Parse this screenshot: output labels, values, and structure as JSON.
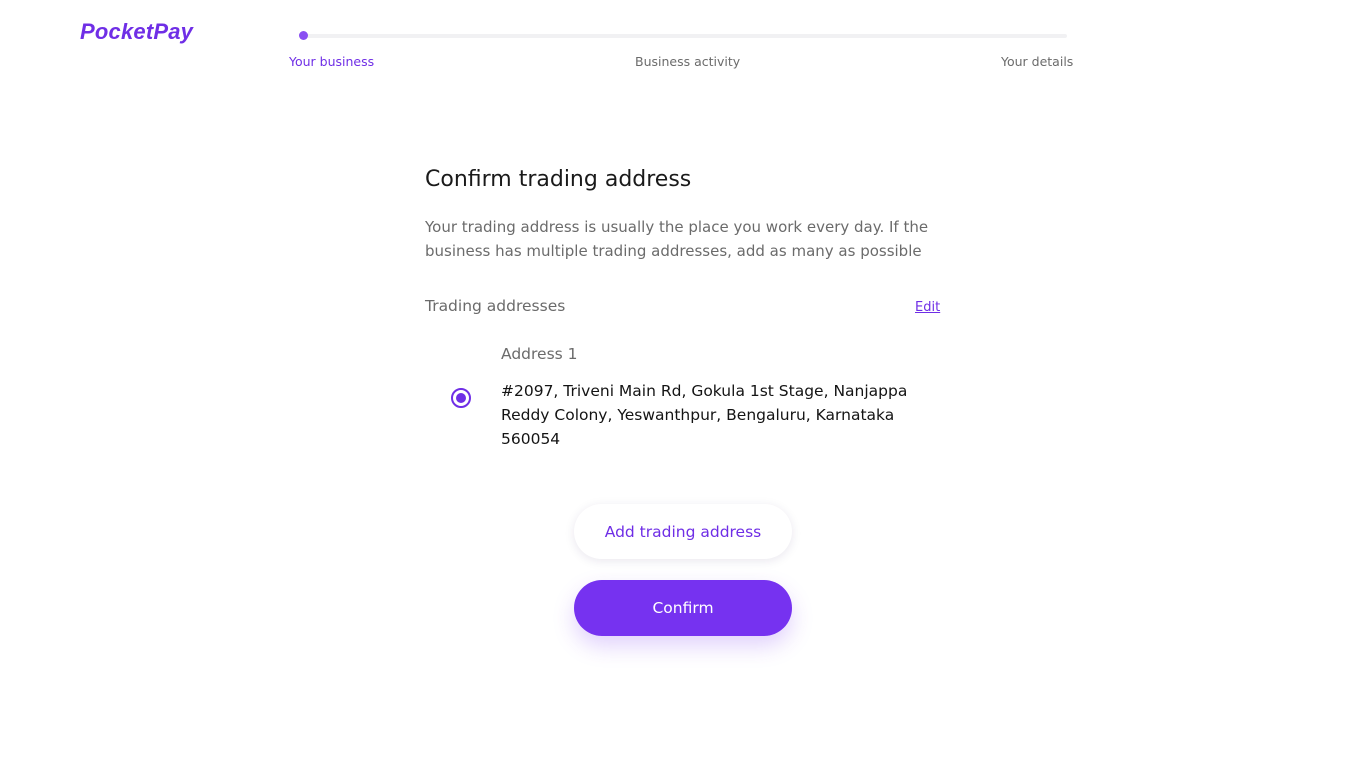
{
  "brand": {
    "name": "PocketPay",
    "accent_color": "#6f2ee6"
  },
  "progress": {
    "current_step": 1,
    "total_steps": 3,
    "fraction_complete": 0.0,
    "steps": [
      {
        "label": "Your business",
        "active": true
      },
      {
        "label": "Business activity",
        "active": false
      },
      {
        "label": "Your details",
        "active": false
      }
    ]
  },
  "main": {
    "title": "Confirm trading address",
    "description": "Your trading address is usually the place you work every day. If the business has multiple trading addresses, add as many as possible",
    "section_label": "Trading addresses",
    "edit_label": "Edit",
    "addresses": [
      {
        "label": "Address 1",
        "text": "#2097, Triveni Main Rd, Gokula 1st Stage, Nanjappa Reddy Colony, Yeswanthpur, Bengaluru, Karnataka 560054",
        "selected": true
      }
    ],
    "add_button_label": "Add trading address",
    "confirm_button_label": "Confirm"
  }
}
